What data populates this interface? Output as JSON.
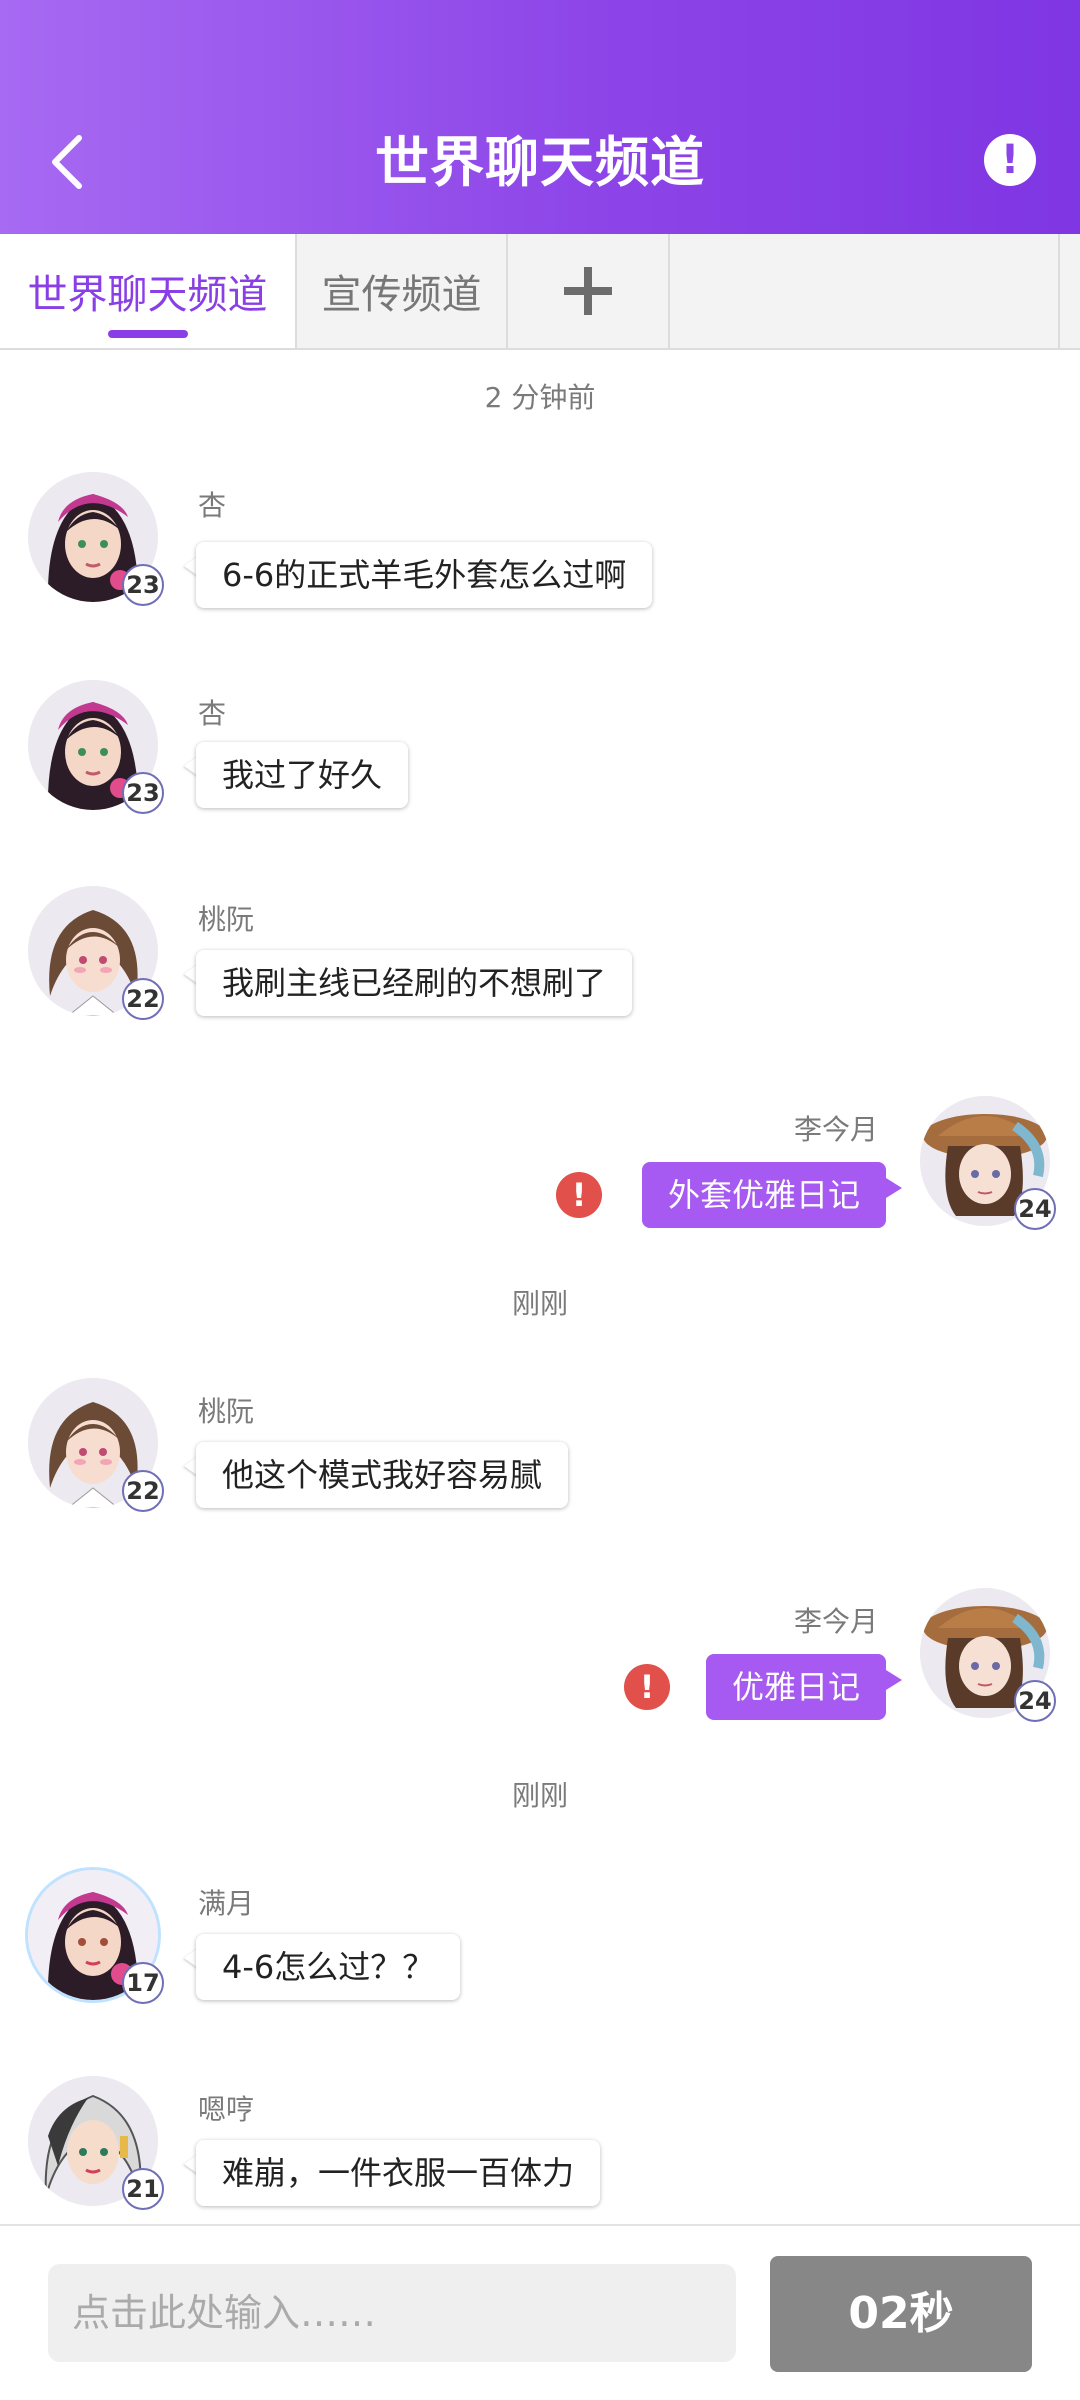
{
  "header": {
    "title": "世界聊天频道",
    "back_icon": "chevron-left-icon",
    "info_icon": "exclamation-circle-icon"
  },
  "tabs": [
    {
      "label": "世界聊天频道",
      "active": true
    },
    {
      "label": "宣传频道",
      "active": false
    },
    {
      "label": "+",
      "active": false
    }
  ],
  "chat": {
    "timestamps": [
      "2 分钟前",
      "刚刚",
      "刚刚"
    ],
    "messages": [
      {
        "user": "杏",
        "level": "23",
        "text": "6-6的正式羊毛外套怎么过啊",
        "direction": "in"
      },
      {
        "user": "杏",
        "level": "23",
        "text": "我过了好久",
        "direction": "in"
      },
      {
        "user": "桃阮",
        "level": "22",
        "text": "我刷主线已经刷的不想刷了",
        "direction": "in"
      },
      {
        "user": "李今月",
        "level": "24",
        "text": "外套优雅日记",
        "direction": "out",
        "failed": true
      },
      {
        "user": "桃阮",
        "level": "22",
        "text": "他这个模式我好容易腻",
        "direction": "in"
      },
      {
        "user": "李今月",
        "level": "24",
        "text": "优雅日记",
        "direction": "out",
        "failed": true
      },
      {
        "user": "满月",
        "level": "17",
        "text": "4-6怎么过？？",
        "direction": "in"
      },
      {
        "user": "嗯哼",
        "level": "21",
        "text": "难崩，一件衣服一百体力",
        "direction": "in"
      }
    ]
  },
  "input": {
    "placeholder": "点击此处输入……",
    "send_label": "02秒"
  },
  "colors": {
    "header_gradient_start": "#a76af2",
    "header_gradient_end": "#7f36e3",
    "accent": "#8a3fe6",
    "outgoing_bubble": "#a65af1",
    "error": "#e2504b",
    "send_button": "#878787"
  }
}
